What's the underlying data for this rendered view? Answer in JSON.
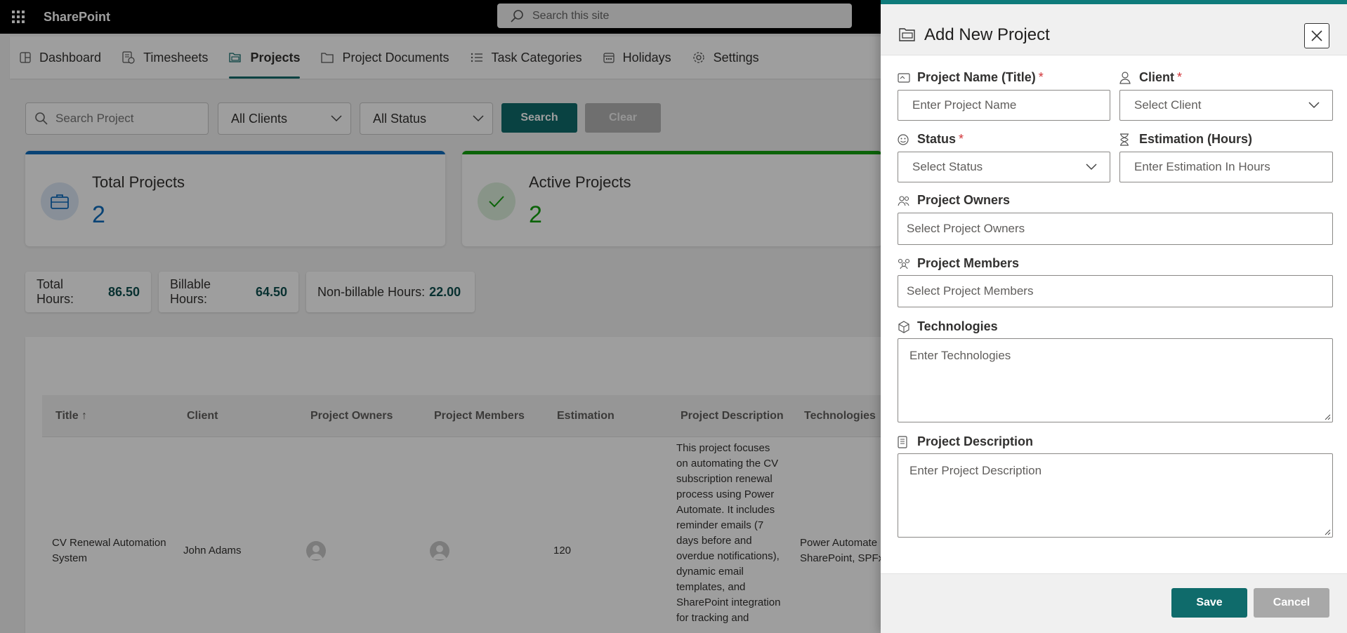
{
  "suitebar": {
    "brand": "SharePoint",
    "search_placeholder": "Search this site"
  },
  "nav": {
    "tabs": [
      {
        "label": "Dashboard",
        "icon": "dashboard-icon"
      },
      {
        "label": "Timesheets",
        "icon": "timesheet-icon"
      },
      {
        "label": "Projects",
        "icon": "projects-icon",
        "active": true
      },
      {
        "label": "Project Documents",
        "icon": "folder-icon"
      },
      {
        "label": "Task Categories",
        "icon": "list-icon"
      },
      {
        "label": "Holidays",
        "icon": "calendar-icon"
      },
      {
        "label": "Settings",
        "icon": "gear-icon"
      }
    ]
  },
  "filters": {
    "search_placeholder": "Search Project",
    "client_value": "All Clients",
    "status_value": "All Status",
    "search_label": "Search",
    "clear_label": "Clear"
  },
  "stats": {
    "total_label": "Total Projects",
    "total_value": "2",
    "active_label": "Active Projects",
    "active_value": "2"
  },
  "hours": {
    "total_label": "Total Hours:",
    "total_value": "86.50",
    "billable_label": "Billable Hours:",
    "billable_value": "64.50",
    "nonbillable_label": "Non-billable Hours:",
    "nonbillable_value": "22.00"
  },
  "table": {
    "columns": [
      "Title ↑",
      "Client",
      "Project Owners",
      "Project Members",
      "Estimation",
      "Project Description",
      "Technologies"
    ],
    "rows": [
      {
        "title_line1": "CV Renewal Automation",
        "title_line2": "System",
        "client": "John Adams",
        "estimation": "120",
        "description_lines": [
          "This project focuses",
          "on automating the CV",
          "subscription renewal",
          "process using Power",
          "Automate. It includes",
          "reminder emails (7",
          "days before and",
          "overdue notifications),",
          "dynamic email",
          "templates, and",
          "SharePoint integration",
          "for tracking and"
        ],
        "tech_line1": "Power Automate",
        "tech_line2": "SharePoint, SPFx"
      }
    ]
  },
  "panel": {
    "title": "Add New Project",
    "fields": {
      "name_label": "Project Name (Title)",
      "name_placeholder": "Enter Project Name",
      "client_label": "Client",
      "client_placeholder": "Select Client",
      "status_label": "Status",
      "status_placeholder": "Select Status",
      "estimation_label": "Estimation (Hours)",
      "estimation_placeholder": "Enter Estimation In Hours",
      "owners_label": "Project Owners",
      "owners_placeholder": "Select Project Owners",
      "members_label": "Project Members",
      "members_placeholder": "Select Project Members",
      "tech_label": "Technologies",
      "tech_placeholder": "Enter Technologies",
      "desc_label": "Project Description",
      "desc_placeholder": "Enter Project Description",
      "required_mark": "*"
    },
    "save_label": "Save",
    "cancel_label": "Cancel"
  },
  "colors": {
    "accent": "#0f6b6b",
    "blue": "#0f6cbd",
    "green": "#13a10e",
    "required": "#d13438"
  }
}
